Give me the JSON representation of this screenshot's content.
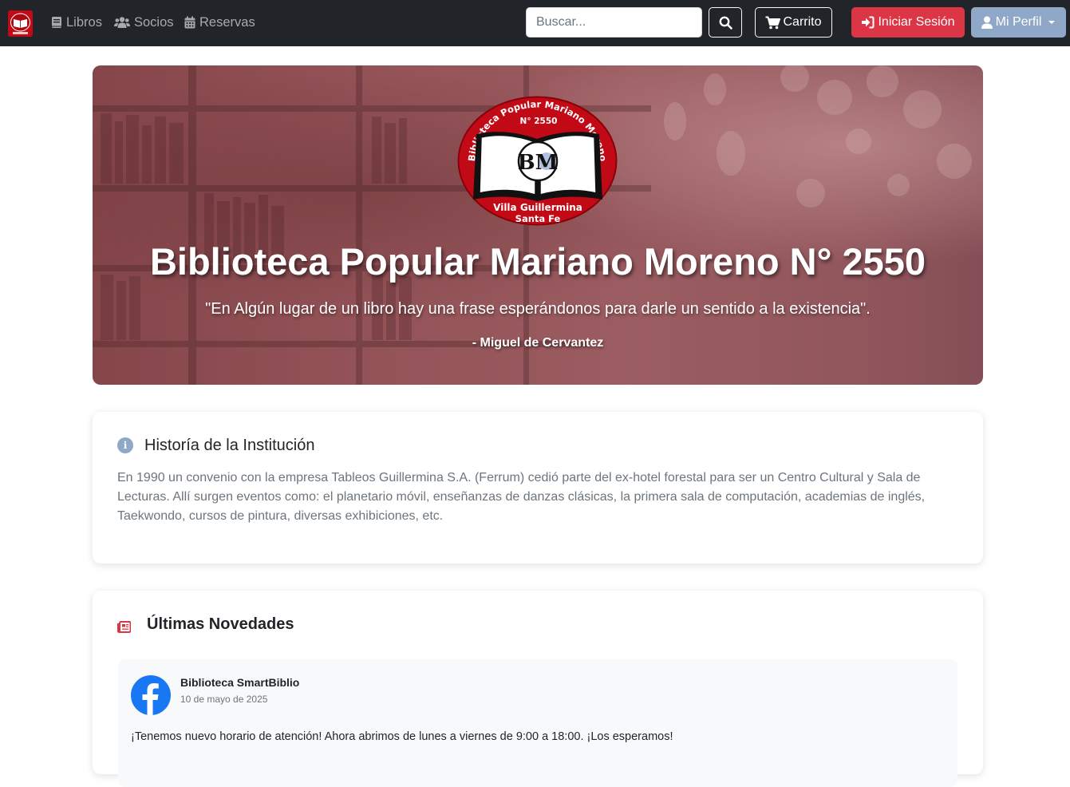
{
  "navbar": {
    "brand_icon": "library-seal-logo",
    "links": [
      {
        "label": "Libros",
        "icon": "book-icon"
      },
      {
        "label": "Socios",
        "icon": "users-icon"
      },
      {
        "label": "Reservas",
        "icon": "calendar-icon"
      }
    ],
    "search": {
      "placeholder": "Buscar...",
      "value": "",
      "button_icon": "search-icon"
    },
    "cart_label": "Carrito",
    "login_label": "Iniciar Sesión",
    "profile_label": "Mi Perfil"
  },
  "hero": {
    "seal": {
      "arc_text": "Biblioteca Popular Mariano Moreno",
      "number": "N° 2550",
      "monogram": "BM",
      "city": "Villa Guillermina",
      "province": "Santa Fe"
    },
    "title": "Biblioteca Popular Mariano Moreno N° 2550",
    "quote": "\"En Algún lugar de un libro hay una frase esperándonos para darle un sentido a la existencia\".",
    "author": "- Miguel de Cervantez"
  },
  "history": {
    "icon": "info-circle-icon",
    "title": "Historía de la Institución",
    "text": "En 1990 un convenio con la empresa Tableos Guillermina S.A. (Ferrum) cedió parte del ex-hotel forestal para ser un Centro Cultural y Sala de Lecturas. Allí surgen eventos como: el planetario móvil, enseñanzas de danzas clásicas, la primera sala de computación, academias de inglés, Taekwondo, cursos de pintura, diversas exhibiciones, etc."
  },
  "news": {
    "icon": "newspaper-icon",
    "title": "Últimas Novedades",
    "posts": [
      {
        "icon": "facebook-icon",
        "author": "Biblioteca SmartBiblio",
        "date": "10 de mayo de 2025",
        "text": "¡Tenemos nuevo horario de atención! Ahora abrimos de lunes a viernes de 9:00 a 18:00. ¡Los esperamos!"
      }
    ]
  },
  "colors": {
    "navbar_bg": "#212529",
    "danger": "#dc3545",
    "profile_btn": "#8fa8c8",
    "seal_red": "#c20a16",
    "facebook_blue": "#1877f2"
  }
}
